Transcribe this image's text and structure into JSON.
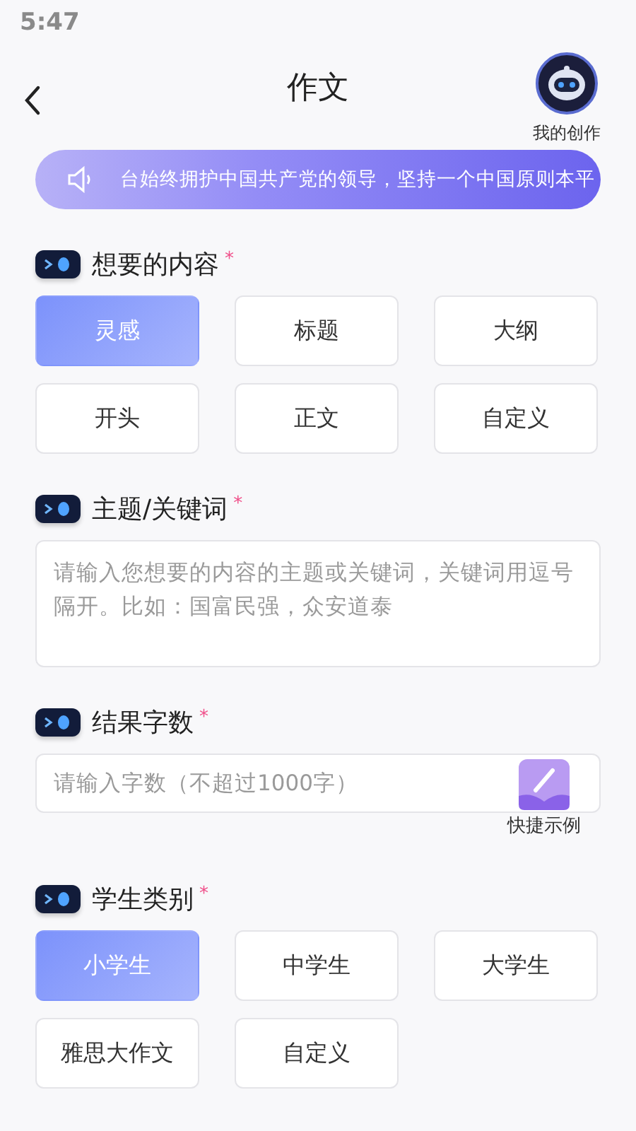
{
  "status_bar": {
    "time": "5:47"
  },
  "header": {
    "title": "作文",
    "my_works": "我的创作"
  },
  "notice": {
    "text": "台始终拥护中国共产党的领导，坚持一个中国原则本平"
  },
  "sections": [
    {
      "kind": "options",
      "title": "想要的内容",
      "required_mark": "*",
      "options": [
        {
          "label": "灵感",
          "selected": true
        },
        {
          "label": "标题",
          "selected": false
        },
        {
          "label": "大纲",
          "selected": false
        },
        {
          "label": "开头",
          "selected": false
        },
        {
          "label": "正文",
          "selected": false
        },
        {
          "label": "自定义",
          "selected": false
        }
      ]
    },
    {
      "kind": "textarea",
      "title": "主题/关键词",
      "required_mark": "*",
      "placeholder": "请输入您想要的内容的主题或关键词，关键词用逗号隔开。比如：国富民强，众安道泰"
    },
    {
      "kind": "input",
      "title": "结果字数",
      "required_mark": "*",
      "placeholder": "请输入字数（不超过1000字）",
      "quick_example": "快捷示例"
    },
    {
      "kind": "options",
      "title": "学生类别",
      "required_mark": "*",
      "options": [
        {
          "label": "小学生",
          "selected": true
        },
        {
          "label": "中学生",
          "selected": false
        },
        {
          "label": "大学生",
          "selected": false
        },
        {
          "label": "雅思大作文",
          "selected": false
        },
        {
          "label": "自定义",
          "selected": false
        }
      ]
    }
  ]
}
